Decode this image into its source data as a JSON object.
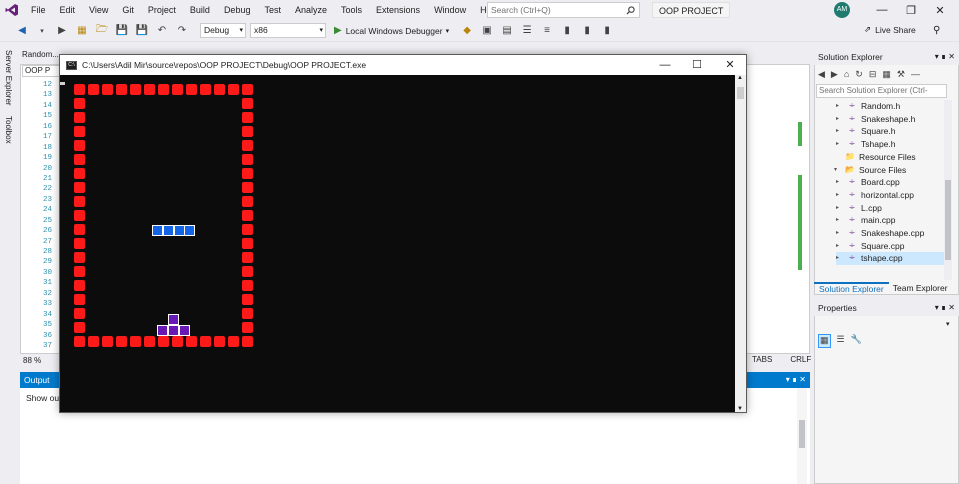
{
  "menu": [
    "File",
    "Edit",
    "View",
    "Git",
    "Project",
    "Build",
    "Debug",
    "Test",
    "Analyze",
    "Tools",
    "Extensions",
    "Window",
    "Help"
  ],
  "search_placeholder": "Search (Ctrl+Q)",
  "project_title": "OOP PROJECT",
  "avatar_initials": "AM",
  "toolbar": {
    "config": "Debug",
    "platform": "x86",
    "run_label": "Local Windows Debugger"
  },
  "live_share": "Live Share",
  "side_tabs": [
    "Server Explorer",
    "Toolbox"
  ],
  "editor": {
    "tab_label": "Random...",
    "file_dropdown": "OOP P",
    "line_numbers": [
      "12",
      "13",
      "14",
      "15",
      "16",
      "17",
      "18",
      "19",
      "20",
      "21",
      "22",
      "23",
      "24",
      "25",
      "26",
      "27",
      "28",
      "29",
      "30",
      "31",
      "32",
      "33",
      "34",
      "35",
      "36",
      "37"
    ],
    "zoom": "88 %",
    "tabs_label": "TABS",
    "crlf_label": "CRLF"
  },
  "output": {
    "title": "Output",
    "show_output_from": "Show ou"
  },
  "console": {
    "title": "C:\\Users\\Adil Mir\\source\\repos\\OOP PROJECT\\Debug\\OOP PROJECT.exe",
    "board_color": "#ff1a1a",
    "active_piece": {
      "shape": "horizontal",
      "color": "#1464e6"
    },
    "landed_piece": {
      "shape": "tshape",
      "color": "#6a1ab4"
    }
  },
  "solution_explorer": {
    "title": "Solution Explorer",
    "search_placeholder": "Search Solution Explorer (Ctrl-",
    "items": [
      {
        "label": "Random.h",
        "type": "header",
        "indent": 1
      },
      {
        "label": "Snakeshape.h",
        "type": "header",
        "indent": 1
      },
      {
        "label": "Square.h",
        "type": "header",
        "indent": 1
      },
      {
        "label": "Tshape.h",
        "type": "header",
        "indent": 1
      },
      {
        "label": "Resource Files",
        "type": "folder",
        "indent": 0
      },
      {
        "label": "Source Files",
        "type": "folder-open",
        "indent": 0
      },
      {
        "label": "Board.cpp",
        "type": "cpp",
        "indent": 1
      },
      {
        "label": "horizontal.cpp",
        "type": "cpp",
        "indent": 1
      },
      {
        "label": "L.cpp",
        "type": "cpp",
        "indent": 1
      },
      {
        "label": "main.cpp",
        "type": "cpp",
        "indent": 1
      },
      {
        "label": "Snakeshape.cpp",
        "type": "cpp",
        "indent": 1
      },
      {
        "label": "Square.cpp",
        "type": "cpp",
        "indent": 1
      },
      {
        "label": "tshape.cpp",
        "type": "cpp",
        "indent": 1,
        "selected": true
      }
    ],
    "tabs": [
      "Solution Explorer",
      "Team Explorer"
    ]
  },
  "properties": {
    "title": "Properties"
  }
}
